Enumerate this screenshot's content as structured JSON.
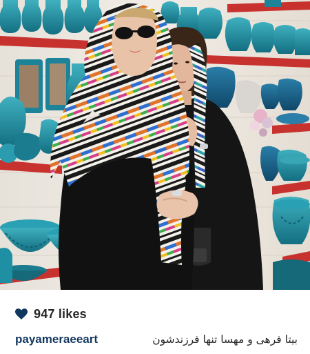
{
  "post": {
    "likes_count": "947 likes",
    "username": "payameraeeart",
    "caption": "بیتا فرهی و مهسا تنها فرزندشون",
    "caption_overflow": "…"
  },
  "icons": {
    "like": "heart-icon"
  },
  "colors": {
    "username": "#12375f",
    "text": "#262626",
    "shelf_red": "#c8322e",
    "pottery_turquoise": "#1f8fa3"
  }
}
